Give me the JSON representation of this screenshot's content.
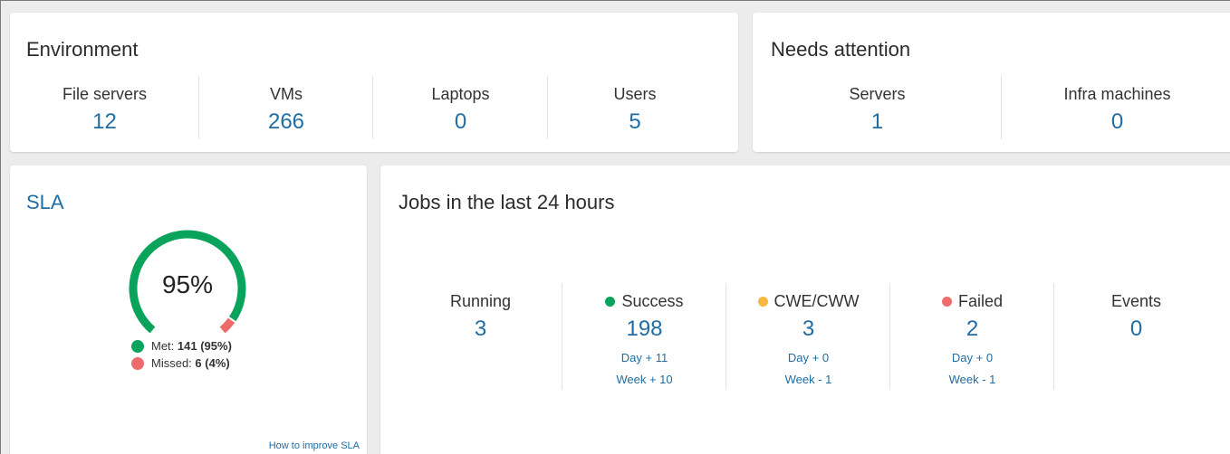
{
  "environment": {
    "title": "Environment",
    "stats": [
      {
        "label": "File servers",
        "value": "12"
      },
      {
        "label": "VMs",
        "value": "266"
      },
      {
        "label": "Laptops",
        "value": "0"
      },
      {
        "label": "Users",
        "value": "5"
      }
    ]
  },
  "attention": {
    "title": "Needs attention",
    "stats": [
      {
        "label": "Servers",
        "value": "1"
      },
      {
        "label": "Infra machines",
        "value": "0"
      }
    ]
  },
  "sla": {
    "title": "SLA",
    "percent_label": "95%",
    "met_fraction": 0.95,
    "met_label": "Met: ",
    "met_value": "141 (95%)",
    "missed_label": "Missed: ",
    "missed_value": "6 (4%)",
    "improve_link": "How to improve SLA"
  },
  "jobs": {
    "title": "Jobs in the last 24 hours",
    "items": [
      {
        "label": "Running",
        "value": "3",
        "day": "",
        "week": ""
      },
      {
        "label": "Success",
        "value": "198",
        "day": "Day + 11",
        "week": "Week + 10"
      },
      {
        "label": "CWE/CWW",
        "value": "3",
        "day": "Day + 0",
        "week": "Week - 1"
      },
      {
        "label": "Failed",
        "value": "2",
        "day": "Day + 0",
        "week": "Week - 1"
      },
      {
        "label": "Events",
        "value": "0",
        "day": "",
        "week": ""
      }
    ]
  },
  "colors": {
    "accent_blue": "#1f6da3",
    "success_green": "#0aa35c",
    "warning_orange": "#f5b942",
    "failed_red": "#ee6b6b"
  }
}
